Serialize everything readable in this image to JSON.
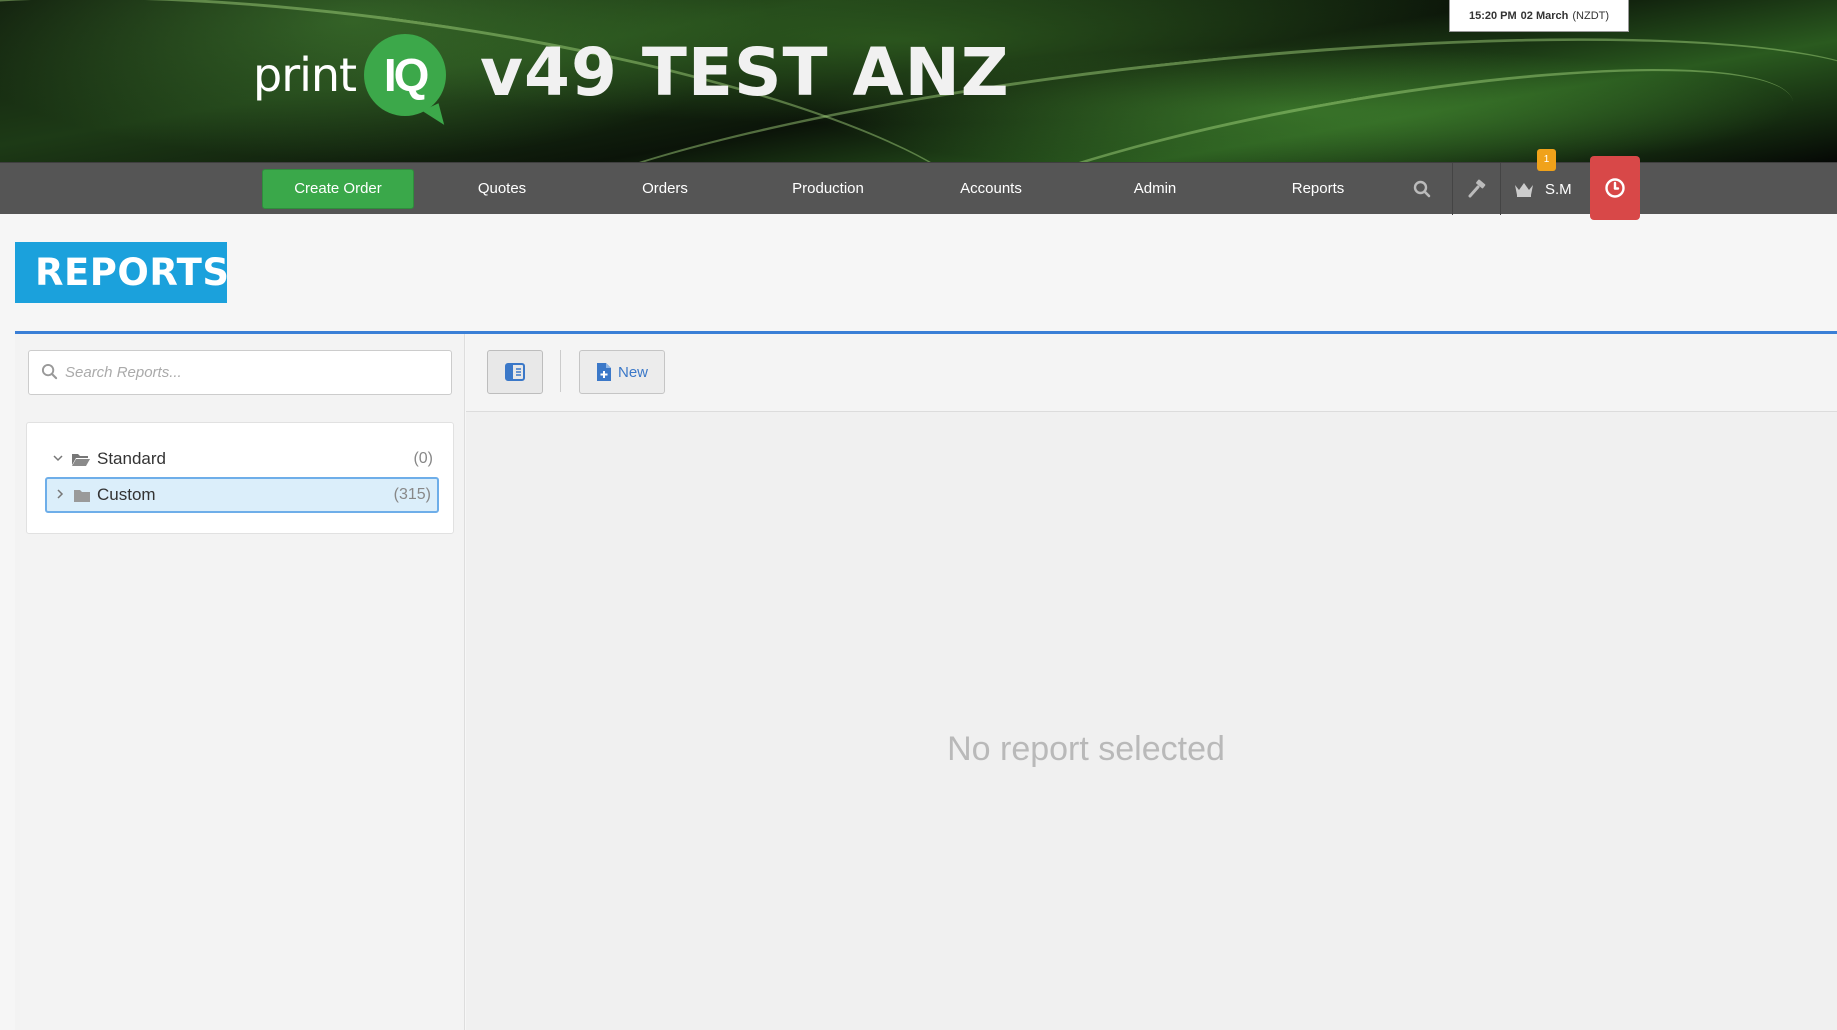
{
  "header": {
    "logo_print": "print",
    "logo_iq": "IQ",
    "site_title": "v49 TEST ANZ",
    "clock": {
      "time": "15:20 PM",
      "date": "02 March",
      "timezone": "(NZDT)"
    }
  },
  "nav": {
    "create_order": "Create Order",
    "items": [
      "Quotes",
      "Orders",
      "Production",
      "Accounts",
      "Admin",
      "Reports"
    ],
    "icons": [
      "search-icon",
      "hammer-icon",
      "crown-icon",
      "power-icon"
    ],
    "user": "S.M",
    "notification_count": "1"
  },
  "page": {
    "title": "REPORTS",
    "search_placeholder": "Search Reports...",
    "tree": [
      {
        "label": "Standard",
        "count": "(0)",
        "expanded": true,
        "selected": false
      },
      {
        "label": "Custom",
        "count": "(315)",
        "expanded": false,
        "selected": true
      }
    ],
    "toolbar": {
      "new_label": "New"
    },
    "empty_message": "No report selected"
  },
  "colors": {
    "nav_bg": "#555555",
    "create_order": "#3aa84a",
    "heading_bg": "#1ba1dc",
    "accent_line": "#3a7fd6",
    "power_btn": "#d84848",
    "badge": "#f0a21a"
  }
}
